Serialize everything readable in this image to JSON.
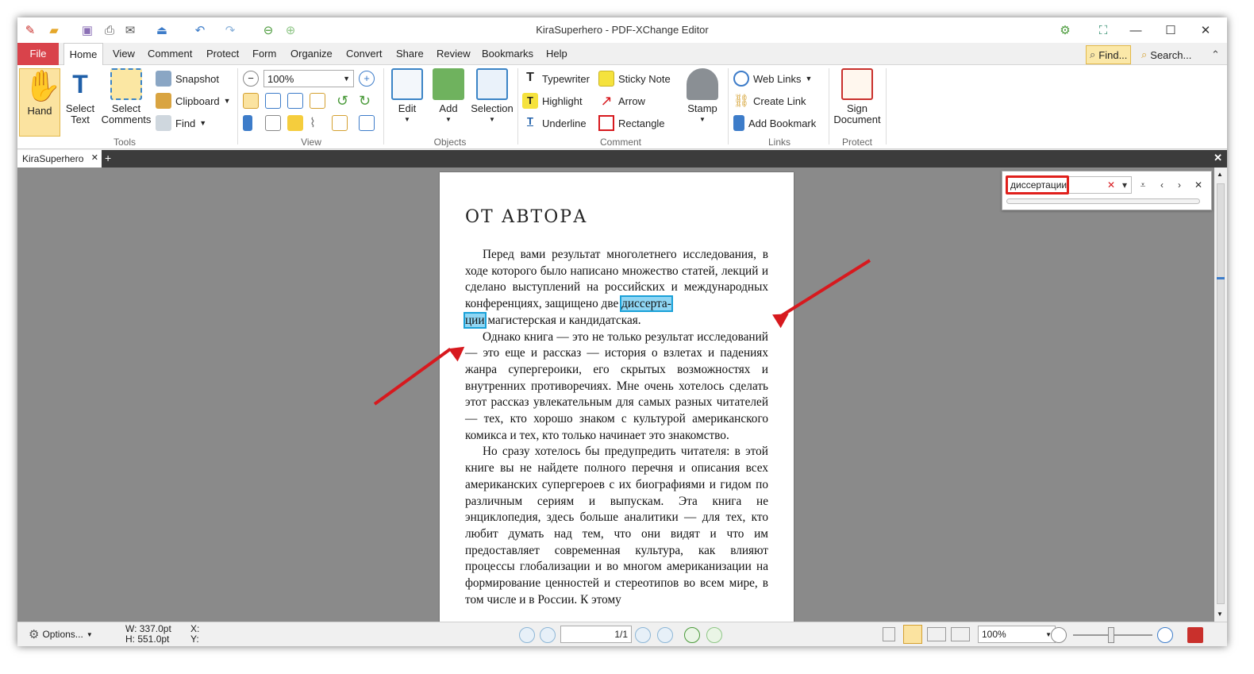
{
  "window": {
    "title": "KiraSuperhero - PDF-XChange Editor"
  },
  "menu": {
    "items": [
      "File",
      "Home",
      "View",
      "Comment",
      "Protect",
      "Form",
      "Organize",
      "Convert",
      "Share",
      "Review",
      "Bookmarks",
      "Help"
    ],
    "find_label": "Find...",
    "search_label": "Search..."
  },
  "ribbon": {
    "tools": {
      "label": "Tools",
      "hand": "Hand",
      "select_text": "Select Text",
      "select_comments": "Select Comments",
      "snapshot": "Snapshot",
      "clipboard": "Clipboard",
      "find": "Find"
    },
    "view": {
      "label": "View",
      "zoom": "100%"
    },
    "objects": {
      "label": "Objects",
      "edit": "Edit",
      "add": "Add",
      "selection": "Selection"
    },
    "comment": {
      "label": "Comment",
      "typewriter": "Typewriter",
      "sticky_note": "Sticky Note",
      "highlight": "Highlight",
      "arrow": "Arrow",
      "underline": "Underline",
      "rectangle": "Rectangle",
      "stamp": "Stamp"
    },
    "links": {
      "label": "Links",
      "web_links": "Web Links",
      "create_link": "Create Link",
      "add_bookmark": "Add Bookmark"
    },
    "protect": {
      "label": "Protect",
      "sign_document": "Sign Document"
    }
  },
  "doc_tab": {
    "name": "KiraSuperhero"
  },
  "page": {
    "heading": "ОТ АВТОРА",
    "p1_a": "Перед вами результат многолетнего исследования, в ходе которого было написано множество статей, лекций и сделано выступлений на российских и меж­дународных конференциях, защищено две ",
    "p1_hl1": "диссерта-",
    "p1_hl2": "ции",
    "p1_b": " магистерская и кандидатская.",
    "p2": "Однако книга — это не только результат иссле­дований — это еще и рассказ — история о взлетах и падениях жанра супергероики, его скрытых воз­можностях и внутренних противоречиях. Мне очень хотелось сделать этот рассказ увлекательным для самых разных читателей — тех, кто хорошо знаком с культурой американского комикса и тех, кто толь­ко начинает это знакомство.",
    "p3": "Но сразу хотелось бы предупредить читателя: в этой книге вы не найдете полного перечня и описа­ния всех американских супергероев с их биографи­ями и гидом по различным сериям и выпускам. Эта книга не энциклопедия, здесь больше аналитики — для тех, кто любит думать над тем, что они видят и что им предоставляет современная культура, как влияют процессы глобализации и во многом амери­канизации на формирование ценностей и стереоти­пов во всем мире, в том числе и в России. К этому"
  },
  "find_panel": {
    "query": "диссертации"
  },
  "status": {
    "options": "Options...",
    "width": "W: 337.0pt",
    "height": "H: 551.0pt",
    "x": "X:",
    "y": "Y:",
    "page": "1/1",
    "zoom": "100%"
  },
  "colors": {
    "accent": "#d9434b",
    "highlight": "#8fd6f4",
    "annotation_red": "#d7191e"
  }
}
